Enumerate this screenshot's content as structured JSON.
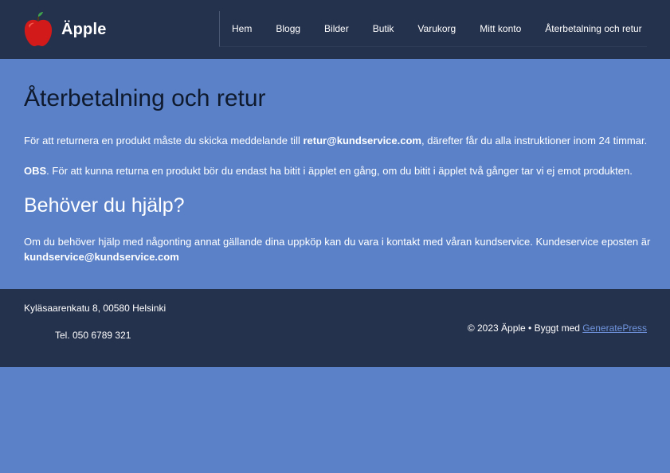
{
  "colors": {
    "header_bg": "#25324d",
    "page_bg": "#5b82c8",
    "title_text": "#0f1a2e",
    "link": "#6f94dd"
  },
  "header": {
    "logo_icon": "red-apple-icon",
    "site_title": "Äpple",
    "nav": [
      {
        "label": "Hem"
      },
      {
        "label": "Blogg"
      },
      {
        "label": "Bilder"
      },
      {
        "label": "Butik"
      },
      {
        "label": "Varukorg"
      },
      {
        "label": "Mitt konto"
      },
      {
        "label": "Återbetalning och retur"
      }
    ]
  },
  "main": {
    "title": "Återbetalning och retur",
    "p1_pre": "För att returnera en produkt måste du skicka meddelande till ",
    "p1_email": "retur@kundservice.com",
    "p1_post": ", därefter får du alla instruktioner inom 24 timmar.",
    "p2_bold": "OBS",
    "p2_text": ". För att kunna returna en produkt bör du endast ha bitit i äpplet en gång, om du bitit i äpplet två gånger tar vi ej emot produkten.",
    "help_title": "Behöver du hjälp?",
    "p3_text": "Om du behöver hjälp med någonting annat gällande dina uppköp kan du vara i kontakt med våran kundservice. Kundeservice eposten är",
    "p3_email": "kundservice@kundservice.com"
  },
  "footer": {
    "address": "Kyläsaarenkatu 8, 00580 Helsinki",
    "phone": "Tel. 050 6789 321",
    "copyright_pre": "© 2023 Äpple • Byggt med ",
    "copyright_link": "GeneratePress"
  }
}
